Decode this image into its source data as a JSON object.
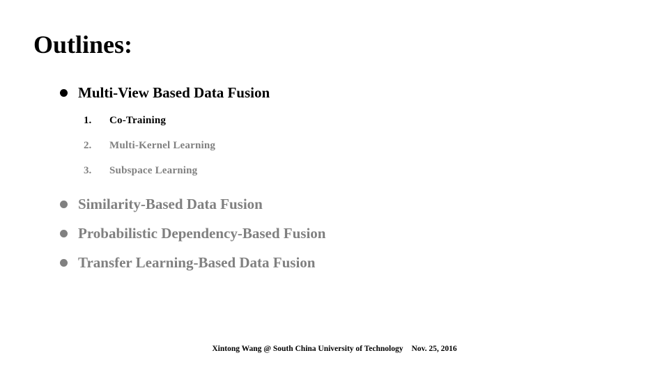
{
  "slide": {
    "title": "Outlines:",
    "background_color": "#ffffff",
    "active_color": "#000000",
    "dim_color": "#808080",
    "bullets": [
      {
        "label": "Multi-View Based Data Fusion",
        "state": "active",
        "bullet_icon": "filled-circle-bullet-icon",
        "subitems": [
          {
            "number": "1.",
            "label": "Co-Training",
            "state": "active"
          },
          {
            "number": "2.",
            "label": "Multi-Kernel Learning",
            "state": "dim"
          },
          {
            "number": "3.",
            "label": "Subspace Learning",
            "state": "dim"
          }
        ]
      },
      {
        "label": "Similarity-Based Data Fusion",
        "state": "dim",
        "bullet_icon": "filled-circle-bullet-icon",
        "subitems": []
      },
      {
        "label": "Probabilistic Dependency-Based Fusion",
        "state": "dim",
        "bullet_icon": "filled-circle-bullet-icon",
        "subitems": []
      },
      {
        "label": "Transfer Learning-Based Data Fusion",
        "state": "dim",
        "bullet_icon": "filled-circle-bullet-icon",
        "subitems": []
      }
    ]
  },
  "footer": {
    "author_affiliation": "Xintong Wang @ South China University of Technology",
    "date": "Nov. 25, 2016"
  }
}
